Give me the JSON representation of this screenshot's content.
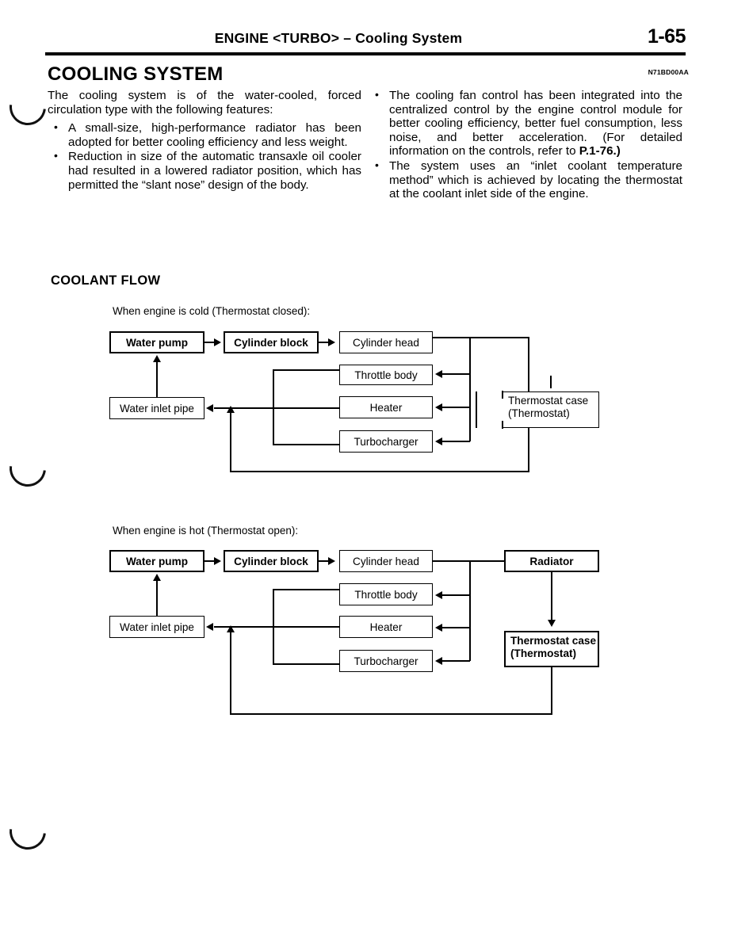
{
  "header": {
    "title": "ENGINE <TURBO> – Cooling System",
    "page_number": "1-65"
  },
  "section": {
    "title": "COOLING SYSTEM",
    "doc_code": "N71BD00AA"
  },
  "intro": {
    "left": {
      "lead": "The cooling system is of the water-cooled, forced circulation type with the following features:",
      "bullets": [
        "A small-size, high-performance radiator has been adopted for better cooling efficiency and less weight.",
        "Reduction in size of the automatic transaxle oil cooler had resulted in a lowered radiator position, which has permitted the “slant nose” design of the body."
      ]
    },
    "right": {
      "bullet1_part1": "The cooling fan control has been integrated into the centralized control by the engine control module for better cooling efficiency, better fuel consumption, less noise, and better acceleration. (For detailed information on the controls, refer to ",
      "bullet1_ref": "P.1-76.)",
      "bullet2": "The system uses an “inlet coolant temperature method” which is achieved by locating the thermostat at the coolant inlet side of the engine."
    }
  },
  "coolant_flow": {
    "title": "COOLANT FLOW",
    "diagram_cold": {
      "caption": "When engine is cold (Thermostat closed):",
      "nodes": {
        "water_pump": "Water pump",
        "cylinder_block": "Cylinder block",
        "cylinder_head": "Cylinder head",
        "throttle_body": "Throttle body",
        "heater": "Heater",
        "turbocharger": "Turbocharger",
        "water_inlet_pipe": "Water inlet pipe",
        "thermostat_case_l1": "Thermostat  case",
        "thermostat_case_l2": "(Thermostat)"
      }
    },
    "diagram_hot": {
      "caption": "When engine is hot (Thermostat open):",
      "nodes": {
        "water_pump": "Water pump",
        "cylinder_block": "Cylinder block",
        "cylinder_head": "Cylinder head",
        "throttle_body": "Throttle body",
        "heater": "Heater",
        "turbocharger": "Turbocharger",
        "water_inlet_pipe": "Water inlet pipe",
        "radiator": "Radiator",
        "thermostat_case_l1": "Thermostat case",
        "thermostat_case_l2": "(Thermostat)"
      }
    }
  }
}
